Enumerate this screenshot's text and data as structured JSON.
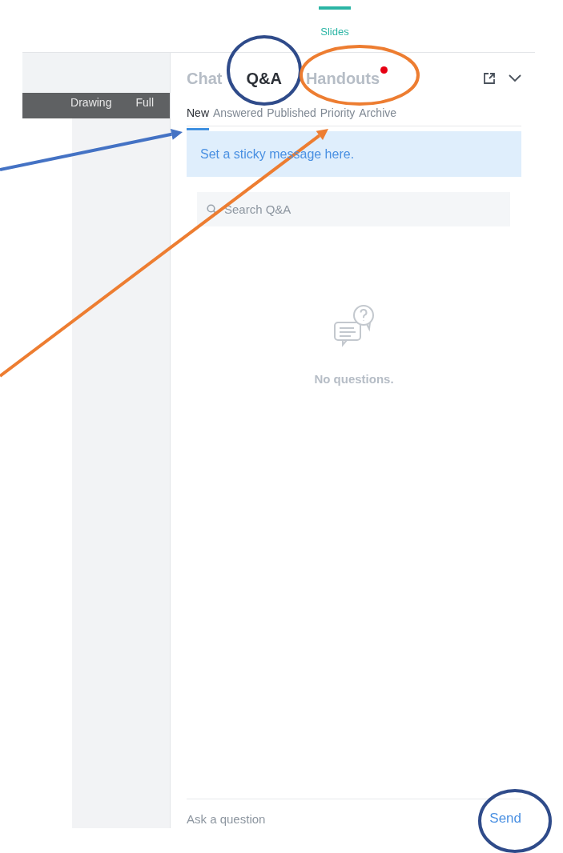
{
  "top_nav": {
    "label": "Slides",
    "selected": true
  },
  "toolbar": {
    "items": [
      "Drawing",
      "Full"
    ]
  },
  "panel": {
    "tabs": [
      {
        "label": "Chat",
        "selected": false
      },
      {
        "label": "Q&A",
        "selected": true
      },
      {
        "label": "Handouts",
        "selected": false,
        "notification": true
      }
    ],
    "subtabs": [
      {
        "label": "New",
        "selected": true
      },
      {
        "label": "Answered",
        "selected": false
      },
      {
        "label": "Published",
        "selected": false
      },
      {
        "label": "Priority",
        "selected": false
      },
      {
        "label": "Archive",
        "selected": false
      }
    ],
    "sticky_message": "Set a sticky message here.",
    "search": {
      "placeholder": "Search Q&A"
    },
    "empty_state": "No questions.",
    "question_input": {
      "placeholder": "Ask a question"
    },
    "send_button": "Send"
  },
  "annotations": [
    {
      "kind": "ellipse",
      "color": "#2f4b8a"
    },
    {
      "kind": "ellipse",
      "color": "#ed7d31"
    },
    {
      "kind": "ellipse",
      "color": "#2f4b8a"
    },
    {
      "kind": "arrow",
      "color": "#4472c4"
    },
    {
      "kind": "arrow",
      "color": "#ed7d31"
    }
  ]
}
